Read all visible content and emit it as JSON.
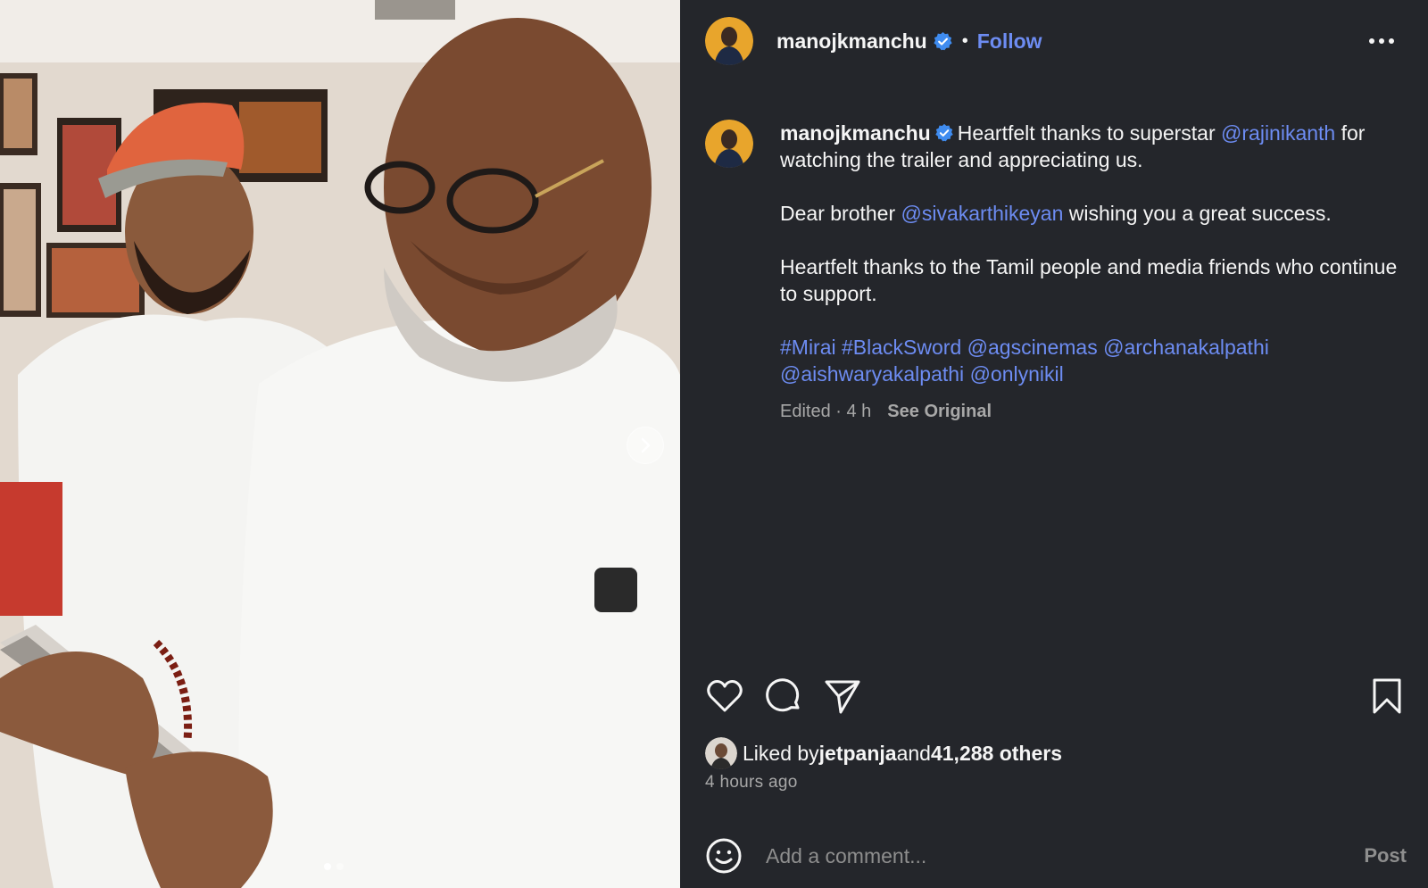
{
  "post": {
    "author": "manojkmanchu",
    "follow_label": "Follow",
    "separator": "•",
    "more_icon": "more-options-icon"
  },
  "caption": {
    "username": "manojkmanchu",
    "line1_pre": "Heartfelt thanks to superstar ",
    "mention1": "@rajinikanth",
    "line1_post": " for watching the trailer and appreciating us.",
    "p2_pre": "Dear brother ",
    "mention2": "@sivakarthikeyan",
    "p2_post": " wishing you a great success.",
    "p3": "Heartfelt thanks to the Tamil people and media friends who continue to support.",
    "tags": [
      "#Mirai",
      "#BlackSword",
      "@agscinemas",
      "@archanakalpathi",
      "@aishwaryakalpathi",
      "@onlynikil"
    ],
    "meta": "Edited · 4 h",
    "see_original": "See Original"
  },
  "actions": {
    "like_icon": "heart-icon",
    "comment_icon": "comment-icon",
    "share_icon": "send-icon",
    "save_icon": "bookmark-icon"
  },
  "likes": {
    "prefix": "Liked by ",
    "user": "jetpanja",
    "middle": " and ",
    "count": "41,288 others"
  },
  "timestamp": "4 hours ago",
  "comment": {
    "placeholder": "Add a comment...",
    "post_label": "Post",
    "emoji_icon": "emoji-icon"
  },
  "carousel": {
    "slide_count": 2,
    "current_slide": 1
  },
  "colors": {
    "panel_bg": "#24262b",
    "link": "#6d8cf2",
    "verified": "#3f8cf0",
    "muted": "#a8a8a8"
  }
}
